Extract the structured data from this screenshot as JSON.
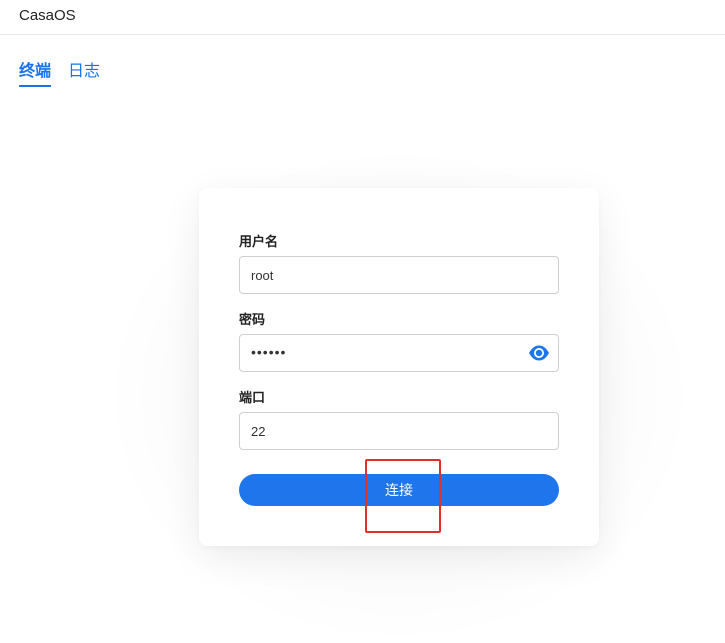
{
  "header": {
    "title": "CasaOS"
  },
  "tabs": [
    {
      "label": "终端",
      "active": true
    },
    {
      "label": "日志",
      "active": false
    }
  ],
  "form": {
    "username": {
      "label": "用户名",
      "value": "root"
    },
    "password": {
      "label": "密码",
      "value": "••••••",
      "toggle_icon": "eye-icon"
    },
    "port": {
      "label": "端口",
      "value": "22"
    },
    "connect_label": "连接"
  },
  "colors": {
    "accent": "#1f75ec",
    "tab_text": "#1a73e8",
    "highlight": "#e0302a"
  }
}
